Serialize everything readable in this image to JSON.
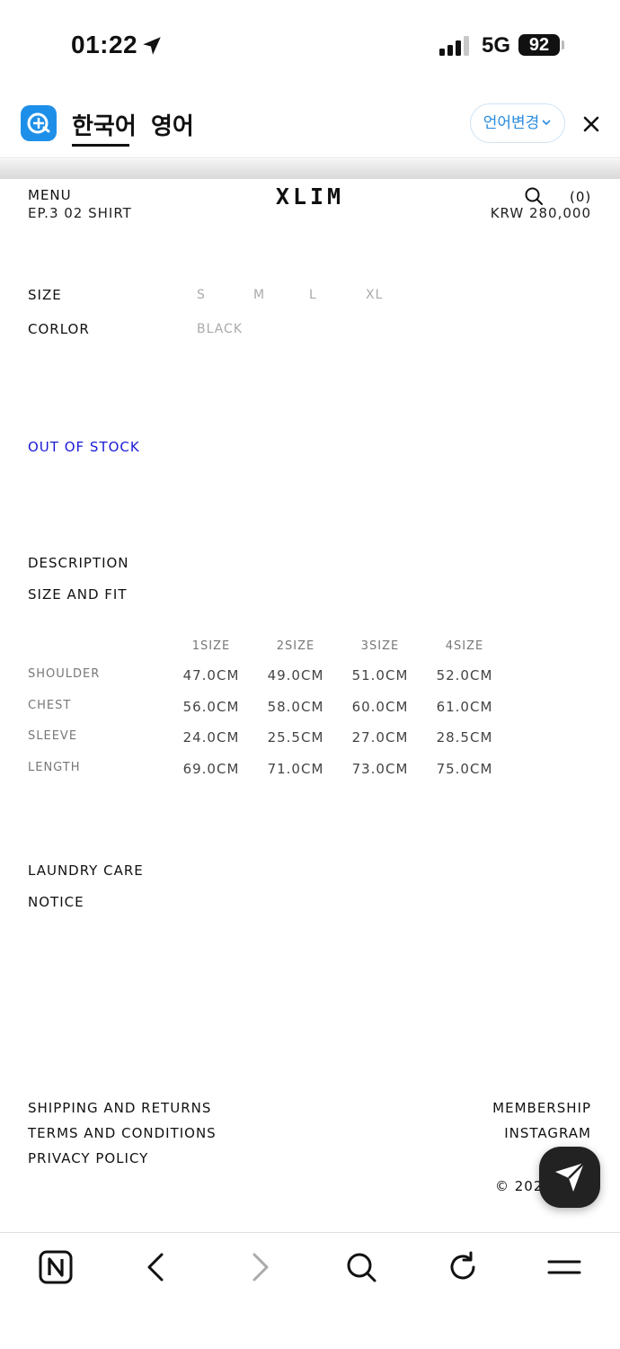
{
  "status_bar": {
    "time": "01:22",
    "network": "5G",
    "battery": "92"
  },
  "translate_bar": {
    "tabs": [
      "한국어",
      "영어"
    ],
    "change_language": "언어변경"
  },
  "header": {
    "menu": "MENU",
    "product_name": "EP.3 02 SHIRT",
    "logo": "XLIM",
    "cart": "(0)",
    "price": "KRW 280,000"
  },
  "options": {
    "size_label": "SIZE",
    "sizes": [
      "S",
      "M",
      "L",
      "XL"
    ],
    "color_label": "CORLOR",
    "colors": [
      "BLACK"
    ]
  },
  "stock_status": "OUT OF STOCK",
  "sections": {
    "description": "DESCRIPTION",
    "size_and_fit": "SIZE AND FIT",
    "laundry_care": "LAUNDRY CARE",
    "notice": "NOTICE"
  },
  "size_table": {
    "columns": [
      "1SIZE",
      "2SIZE",
      "3SIZE",
      "4SIZE"
    ],
    "rows": [
      {
        "label": "SHOULDER",
        "values": [
          "47.0CM",
          "49.0CM",
          "51.0CM",
          "52.0CM"
        ]
      },
      {
        "label": "CHEST",
        "values": [
          "56.0CM",
          "58.0CM",
          "60.0CM",
          "61.0CM"
        ]
      },
      {
        "label": "SLEEVE",
        "values": [
          "24.0CM",
          "25.5CM",
          "27.0CM",
          "28.5CM"
        ]
      },
      {
        "label": "LENGTH",
        "values": [
          "69.0CM",
          "71.0CM",
          "73.0CM",
          "75.0CM"
        ]
      }
    ]
  },
  "footer": {
    "left_links": [
      "SHIPPING AND RETURNS",
      "TERMS AND CONDITIONS",
      "PRIVACY POLICY"
    ],
    "right_links": [
      "MEMBERSHIP",
      "INSTAGRAM"
    ],
    "copyright": "© 202"
  },
  "colors": {
    "accent_link": "#1a1ad6",
    "translate_accent": "#2a8be0",
    "papago_icon": "#1e8fe8"
  }
}
